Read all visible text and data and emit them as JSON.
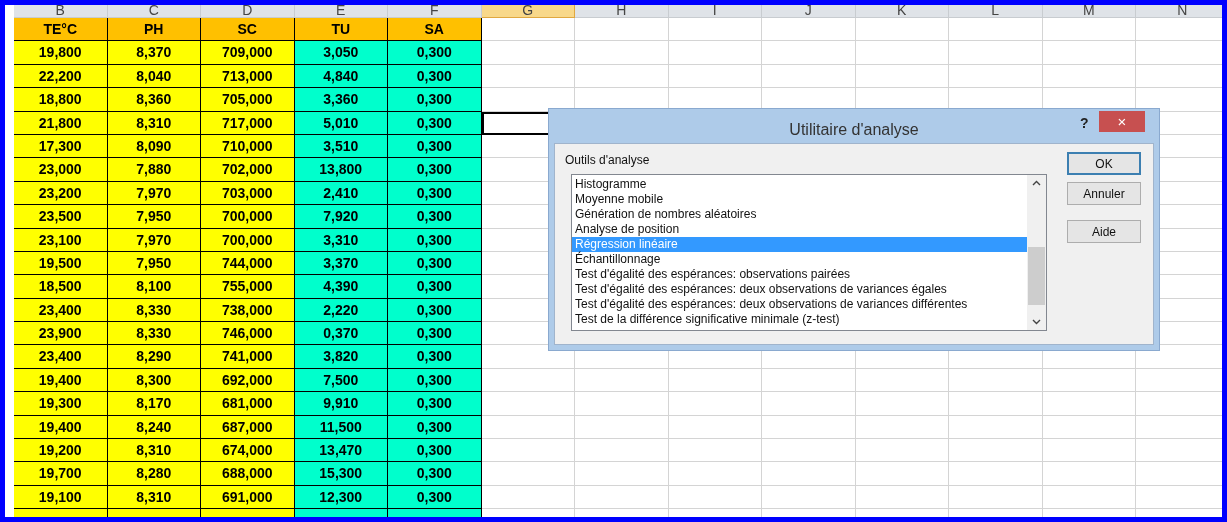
{
  "column_headers": [
    {
      "label": "B",
      "selected": false
    },
    {
      "label": "C",
      "selected": false
    },
    {
      "label": "D",
      "selected": false
    },
    {
      "label": "E",
      "selected": false
    },
    {
      "label": "F",
      "selected": false
    },
    {
      "label": "G",
      "selected": true
    },
    {
      "label": "H",
      "selected": false
    },
    {
      "label": "I",
      "selected": false
    },
    {
      "label": "J",
      "selected": false
    },
    {
      "label": "K",
      "selected": false
    },
    {
      "label": "L",
      "selected": false
    },
    {
      "label": "M",
      "selected": false
    },
    {
      "label": "N",
      "selected": false
    }
  ],
  "table": {
    "columns": [
      "TE°C",
      "PH",
      "SC",
      "TU",
      "SA"
    ],
    "rows": [
      [
        "19,800",
        "8,370",
        "709,000",
        "3,050",
        "0,300"
      ],
      [
        "22,200",
        "8,040",
        "713,000",
        "4,840",
        "0,300"
      ],
      [
        "18,800",
        "8,360",
        "705,000",
        "3,360",
        "0,300"
      ],
      [
        "21,800",
        "8,310",
        "717,000",
        "5,010",
        "0,300"
      ],
      [
        "17,300",
        "8,090",
        "710,000",
        "3,510",
        "0,300"
      ],
      [
        "23,000",
        "7,880",
        "702,000",
        "13,800",
        "0,300"
      ],
      [
        "23,200",
        "7,970",
        "703,000",
        "2,410",
        "0,300"
      ],
      [
        "23,500",
        "7,950",
        "700,000",
        "7,920",
        "0,300"
      ],
      [
        "23,100",
        "7,970",
        "700,000",
        "3,310",
        "0,300"
      ],
      [
        "19,500",
        "7,950",
        "744,000",
        "3,370",
        "0,300"
      ],
      [
        "18,500",
        "8,100",
        "755,000",
        "4,390",
        "0,300"
      ],
      [
        "23,400",
        "8,330",
        "738,000",
        "2,220",
        "0,300"
      ],
      [
        "23,900",
        "8,330",
        "746,000",
        "0,370",
        "0,300"
      ],
      [
        "23,400",
        "8,290",
        "741,000",
        "3,820",
        "0,300"
      ],
      [
        "19,400",
        "8,300",
        "692,000",
        "7,500",
        "0,300"
      ],
      [
        "19,300",
        "8,170",
        "681,000",
        "9,910",
        "0,300"
      ],
      [
        "19,400",
        "8,240",
        "687,000",
        "11,500",
        "0,300"
      ],
      [
        "19,200",
        "8,310",
        "674,000",
        "13,470",
        "0,300"
      ],
      [
        "19,700",
        "8,280",
        "688,000",
        "15,300",
        "0,300"
      ],
      [
        "19,100",
        "8,310",
        "691,000",
        "12,300",
        "0,300"
      ]
    ]
  },
  "dialog": {
    "title": "Utilitaire d'analyse",
    "help": "?",
    "close": "×",
    "label": "Outils d'analyse",
    "items": [
      {
        "label": "Histogramme",
        "selected": false
      },
      {
        "label": "Moyenne mobile",
        "selected": false
      },
      {
        "label": "Génération de nombres aléatoires",
        "selected": false
      },
      {
        "label": "Analyse de position",
        "selected": false
      },
      {
        "label": "Régression linéaire",
        "selected": true
      },
      {
        "label": "Échantillonnage",
        "selected": false
      },
      {
        "label": "Test d'égalité des espérances: observations pairées",
        "selected": false
      },
      {
        "label": "Test d'égalité des espérances: deux observations de variances égales",
        "selected": false
      },
      {
        "label": "Test d'égalité des espérances: deux observations de variances différentes",
        "selected": false
      },
      {
        "label": "Test de la différence significative minimale (z-test)",
        "selected": false
      }
    ],
    "buttons": [
      {
        "label": "OK",
        "default": true
      },
      {
        "label": "Annuler",
        "default": false
      },
      {
        "label": "Aide",
        "default": false
      }
    ]
  }
}
